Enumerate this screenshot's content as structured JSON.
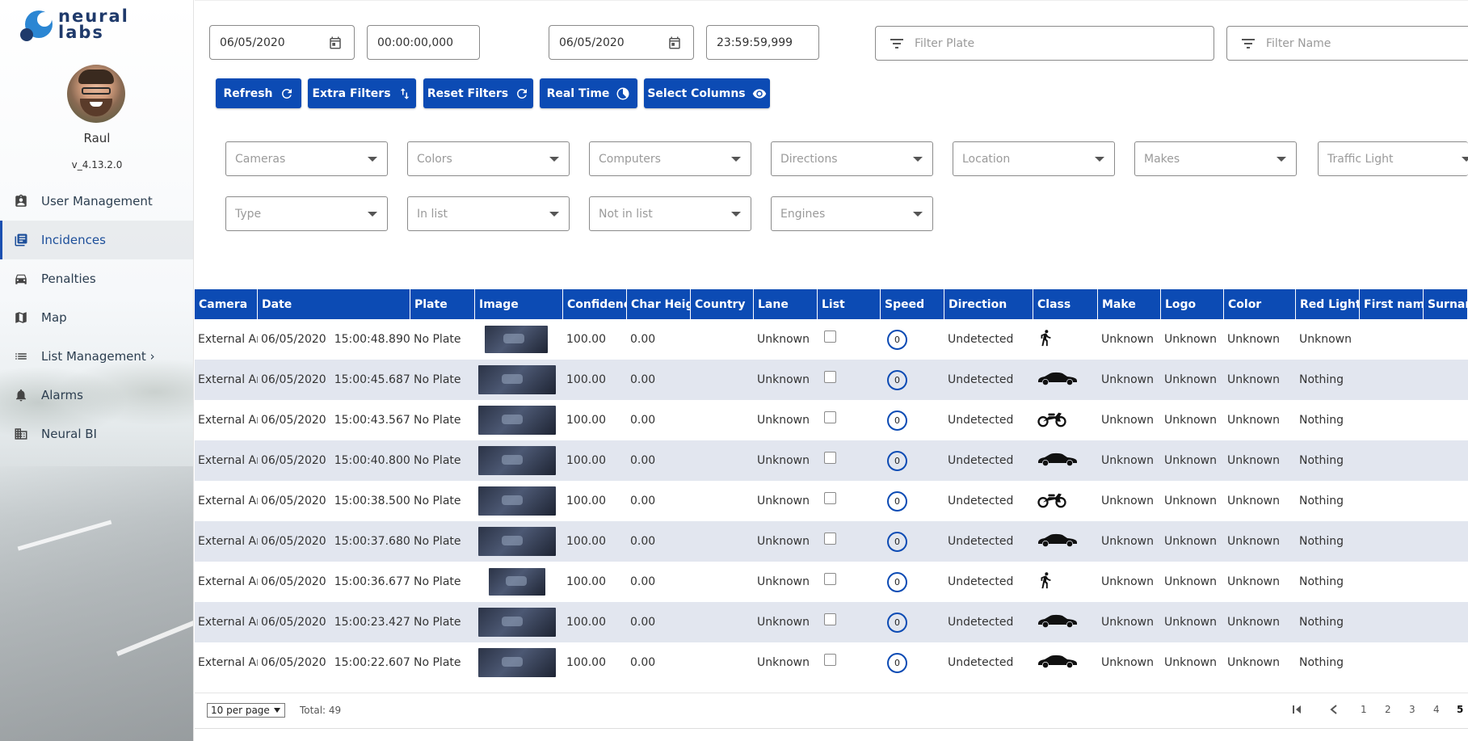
{
  "app": {
    "brand": "neural labs"
  },
  "user": {
    "name": "Raul",
    "version": "v_4.13.2.0"
  },
  "nav": [
    {
      "label": "User Management",
      "icon": "user-badge-icon"
    },
    {
      "label": "Incidences",
      "icon": "document-list-icon",
      "active": true
    },
    {
      "label": "Penalties",
      "icon": "car-icon"
    },
    {
      "label": "Map",
      "icon": "map-icon"
    },
    {
      "label": "List Management ›",
      "icon": "list-icon"
    },
    {
      "label": "Alarms",
      "icon": "bell-icon"
    },
    {
      "label": "Neural BI",
      "icon": "building-icon"
    }
  ],
  "filters": {
    "start_date": "06/05/2020",
    "start_time": "00:00:00,000",
    "end_date": "06/05/2020",
    "end_time": "23:59:59,999",
    "plate_placeholder": "Filter Plate",
    "name_placeholder": "Filter Name"
  },
  "buttons": {
    "refresh": "Refresh",
    "extra": "Extra Filters",
    "reset": "Reset Filters",
    "realtime": "Real Time",
    "columns": "Select Columns"
  },
  "selects": [
    "Cameras",
    "Colors",
    "Computers",
    "Directions",
    "Location",
    "Makes",
    "Traffic Light",
    "Type",
    "In list",
    "Not in list",
    "Engines"
  ],
  "table": {
    "columns": [
      "Camera",
      "Date",
      "Plate",
      "Image",
      "Confidence",
      "Char Height",
      "Country",
      "Lane",
      "List",
      "Speed",
      "Direction",
      "Class",
      "Make",
      "Logo",
      "Color",
      "Red Light",
      "First name",
      "Surname"
    ],
    "rows": [
      {
        "camera": "External An",
        "date": "06/05/2020",
        "time": "15:00:48.890",
        "plate": "No Plate",
        "confidence": "100.00",
        "char_height": "0.00",
        "country": "",
        "lane": "Unknown",
        "speed": "0",
        "direction": "Undetected",
        "class": "pedestrian",
        "make": "Unknown",
        "logo": "Unknown",
        "color": "Unknown",
        "red_light": "Unknown"
      },
      {
        "camera": "External An",
        "date": "06/05/2020",
        "time": "15:00:45.687",
        "plate": "No Plate",
        "confidence": "100.00",
        "char_height": "0.00",
        "country": "",
        "lane": "Unknown",
        "speed": "0",
        "direction": "Undetected",
        "class": "car",
        "make": "Unknown",
        "logo": "Unknown",
        "color": "Unknown",
        "red_light": "Nothing"
      },
      {
        "camera": "External An",
        "date": "06/05/2020",
        "time": "15:00:43.567",
        "plate": "No Plate",
        "confidence": "100.00",
        "char_height": "0.00",
        "country": "",
        "lane": "Unknown",
        "speed": "0",
        "direction": "Undetected",
        "class": "motorcycle",
        "make": "Unknown",
        "logo": "Unknown",
        "color": "Unknown",
        "red_light": "Nothing"
      },
      {
        "camera": "External An",
        "date": "06/05/2020",
        "time": "15:00:40.800",
        "plate": "No Plate",
        "confidence": "100.00",
        "char_height": "0.00",
        "country": "",
        "lane": "Unknown",
        "speed": "0",
        "direction": "Undetected",
        "class": "car",
        "make": "Unknown",
        "logo": "Unknown",
        "color": "Unknown",
        "red_light": "Nothing"
      },
      {
        "camera": "External An",
        "date": "06/05/2020",
        "time": "15:00:38.500",
        "plate": "No Plate",
        "confidence": "100.00",
        "char_height": "0.00",
        "country": "",
        "lane": "Unknown",
        "speed": "0",
        "direction": "Undetected",
        "class": "motorcycle",
        "make": "Unknown",
        "logo": "Unknown",
        "color": "Unknown",
        "red_light": "Nothing"
      },
      {
        "camera": "External An",
        "date": "06/05/2020",
        "time": "15:00:37.680",
        "plate": "No Plate",
        "confidence": "100.00",
        "char_height": "0.00",
        "country": "",
        "lane": "Unknown",
        "speed": "0",
        "direction": "Undetected",
        "class": "car",
        "make": "Unknown",
        "logo": "Unknown",
        "color": "Unknown",
        "red_light": "Nothing"
      },
      {
        "camera": "External An",
        "date": "06/05/2020",
        "time": "15:00:36.677",
        "plate": "No Plate",
        "confidence": "100.00",
        "char_height": "0.00",
        "country": "",
        "lane": "Unknown",
        "speed": "0",
        "direction": "Undetected",
        "class": "pedestrian",
        "make": "Unknown",
        "logo": "Unknown",
        "color": "Unknown",
        "red_light": "Nothing"
      },
      {
        "camera": "External An",
        "date": "06/05/2020",
        "time": "15:00:23.427",
        "plate": "No Plate",
        "confidence": "100.00",
        "char_height": "0.00",
        "country": "",
        "lane": "Unknown",
        "speed": "0",
        "direction": "Undetected",
        "class": "car",
        "make": "Unknown",
        "logo": "Unknown",
        "color": "Unknown",
        "red_light": "Nothing"
      },
      {
        "camera": "External An",
        "date": "06/05/2020",
        "time": "15:00:22.607",
        "plate": "No Plate",
        "confidence": "100.00",
        "char_height": "0.00",
        "country": "",
        "lane": "Unknown",
        "speed": "0",
        "direction": "Undetected",
        "class": "car",
        "make": "Unknown",
        "logo": "Unknown",
        "color": "Unknown",
        "red_light": "Nothing"
      }
    ]
  },
  "pagination": {
    "per_page": "10 per page",
    "total": "Total: 49",
    "pages": [
      "1",
      "2",
      "3",
      "4",
      "5"
    ],
    "current": "5"
  },
  "colors": {
    "primary": "#0c4bb4",
    "row_alt": "#e2e6ef"
  }
}
